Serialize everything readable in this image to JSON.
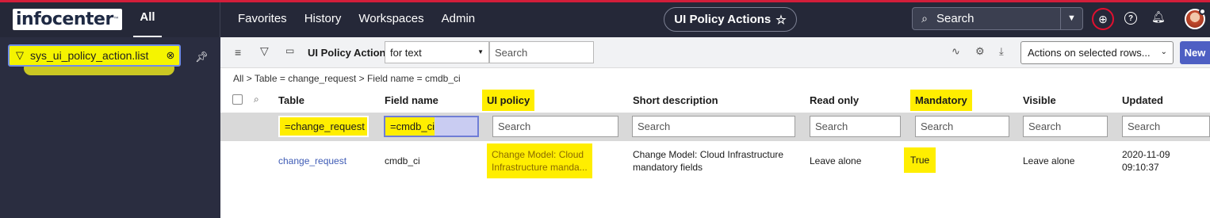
{
  "brand": {
    "logo_text": "infocenter",
    "logo_tm": "™"
  },
  "topbar": {
    "all_tab": "All",
    "nav": [
      "Favorites",
      "History",
      "Workspaces",
      "Admin"
    ],
    "context_title": "UI Policy Actions",
    "search_placeholder": "Search",
    "accent_color": "#d21e3a",
    "bg_color": "#252838"
  },
  "sidebar": {
    "filter_value": "sys_ui_policy_action.list",
    "highlight_color": "#ffee00"
  },
  "list": {
    "title": "UI Policy Actions",
    "search_field_select": "for text",
    "search_placeholder": "Search",
    "actions_select": "Actions on selected rows...",
    "new_label": "New",
    "breadcrumb": [
      "All",
      "Table = change_request",
      "Field name = cmdb_ci"
    ],
    "breadcrumb_sep": ">",
    "columns": [
      "Table",
      "Field name",
      "UI policy",
      "Short description",
      "Read only",
      "Mandatory",
      "Visible",
      "Updated"
    ],
    "filters": {
      "table": "=change_request",
      "field_name": "=cmdb_ci",
      "ui_policy": "Search",
      "short_description": "Search",
      "read_only": "Search",
      "mandatory": "Search",
      "visible": "Search",
      "updated": "Search"
    },
    "rows": [
      {
        "table": "change_request",
        "field_name": "cmdb_ci",
        "ui_policy_line1": "Change Model: Cloud",
        "ui_policy_line2": "Infrastructure manda...",
        "short_desc_line1": "Change Model: Cloud Infrastructure",
        "short_desc_line2": "mandatory fields",
        "read_only": "Leave alone",
        "mandatory": "True",
        "visible": "Leave alone",
        "updated_line1": "2020-11-09",
        "updated_line2": "09:10:37"
      }
    ]
  }
}
